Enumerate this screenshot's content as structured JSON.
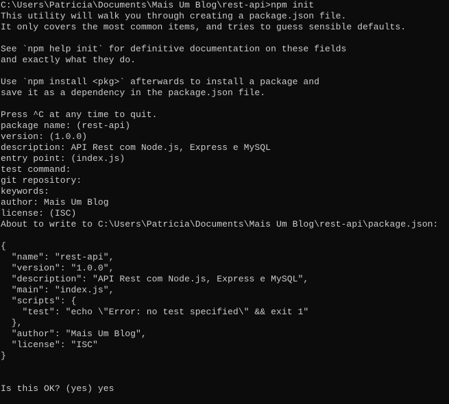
{
  "terminal": {
    "background": "#0c0c0c",
    "foreground": "#cccccc",
    "lines": [
      "C:\\Users\\Patricia\\Documents\\Mais Um Blog\\rest-api>npm init",
      "This utility will walk you through creating a package.json file.",
      "It only covers the most common items, and tries to guess sensible defaults.",
      "",
      "See `npm help init` for definitive documentation on these fields",
      "and exactly what they do.",
      "",
      "Use `npm install <pkg>` afterwards to install a package and",
      "save it as a dependency in the package.json file.",
      "",
      "Press ^C at any time to quit.",
      "package name: (rest-api)",
      "version: (1.0.0)",
      "description: API Rest com Node.js, Express e MySQL",
      "entry point: (index.js)",
      "test command:",
      "git repository:",
      "keywords:",
      "author: Mais Um Blog",
      "license: (ISC)",
      "About to write to C:\\Users\\Patricia\\Documents\\Mais Um Blog\\rest-api\\package.json:",
      "",
      "{",
      "  \"name\": \"rest-api\",",
      "  \"version\": \"1.0.0\",",
      "  \"description\": \"API Rest com Node.js, Express e MySQL\",",
      "  \"main\": \"index.js\",",
      "  \"scripts\": {",
      "    \"test\": \"echo \\\"Error: no test specified\\\" && exit 1\"",
      "  },",
      "  \"author\": \"Mais Um Blog\",",
      "  \"license\": \"ISC\"",
      "}",
      "",
      "",
      "Is this OK? (yes) yes"
    ]
  }
}
